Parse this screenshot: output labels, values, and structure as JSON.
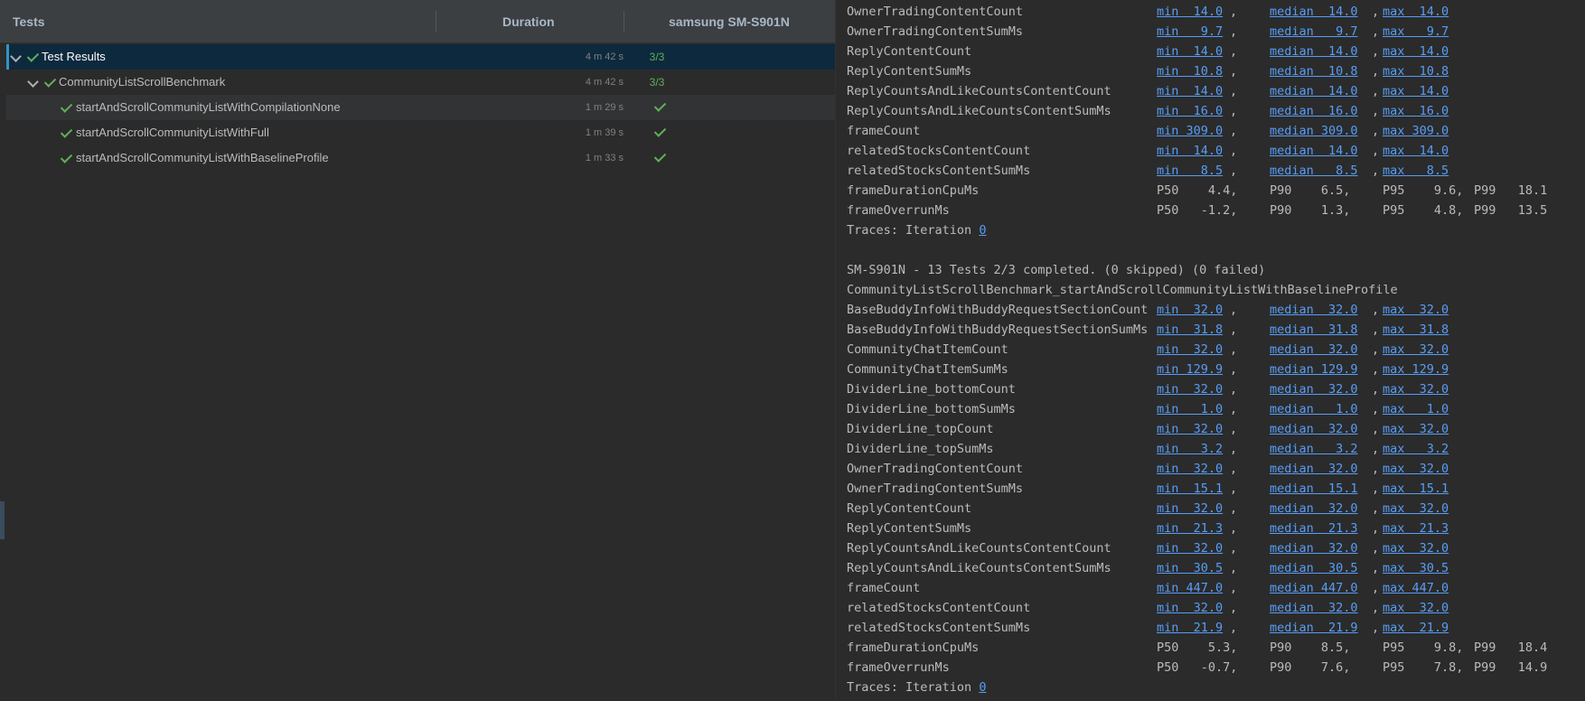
{
  "tree": {
    "header": {
      "tests": "Tests",
      "duration": "Duration",
      "device": "samsung SM-S901N"
    },
    "rows": [
      {
        "label": "Test Results",
        "duration": "4 m 42 s",
        "result": "3/3"
      },
      {
        "label": "CommunityListScrollBenchmark",
        "duration": "4 m 42 s",
        "result": "3/3"
      },
      {
        "label": "startAndScrollCommunityListWithCompilationNone",
        "duration": "1 m 29 s"
      },
      {
        "label": "startAndScrollCommunityListWithFull",
        "duration": "1 m 39 s"
      },
      {
        "label": "startAndScrollCommunityListWithBaselineProfile",
        "duration": "1 m 33 s"
      }
    ]
  },
  "console": {
    "top_metrics": [
      {
        "name": "OwnerTradingContentCount",
        "min": "min  14.0",
        "median": "median  14.0",
        "max": "max  14.0"
      },
      {
        "name": "OwnerTradingContentSumMs",
        "min": "min   9.7",
        "median": "median   9.7",
        "max": "max   9.7"
      },
      {
        "name": "ReplyContentCount",
        "min": "min  14.0",
        "median": "median  14.0",
        "max": "max  14.0"
      },
      {
        "name": "ReplyContentSumMs",
        "min": "min  10.8",
        "median": "median  10.8",
        "max": "max  10.8"
      },
      {
        "name": "ReplyCountsAndLikeCountsContentCount",
        "min": "min  14.0",
        "median": "median  14.0",
        "max": "max  14.0"
      },
      {
        "name": "ReplyCountsAndLikeCountsContentSumMs",
        "min": "min  16.0",
        "median": "median  16.0",
        "max": "max  16.0"
      },
      {
        "name": "frameCount",
        "min": "min 309.0",
        "median": "median 309.0",
        "max": "max 309.0"
      },
      {
        "name": "relatedStocksContentCount",
        "min": "min  14.0",
        "median": "median  14.0",
        "max": "max  14.0"
      },
      {
        "name": "relatedStocksContentSumMs",
        "min": "min   8.5",
        "median": "median   8.5",
        "max": "max   8.5"
      }
    ],
    "top_percentiles": [
      {
        "name": "frameDurationCpuMs",
        "p50": "P50    4.4,",
        "p90": "P90    6.5,",
        "p95": "P95    9.6,",
        "p99": "P99   18.1"
      },
      {
        "name": "frameOverrunMs",
        "p50": "P50   -1.2,",
        "p90": "P90    1.3,",
        "p95": "P95    4.8,",
        "p99": "P99   13.5"
      }
    ],
    "traces_label": "Traces: Iteration ",
    "traces_link": "0",
    "summary_line": "SM-S901N - 13 Tests 2/3 completed. (0 skipped) (0 failed)",
    "benchmark_name": "CommunityListScrollBenchmark_startAndScrollCommunityListWithBaselineProfile",
    "bottom_metrics": [
      {
        "name": "BaseBuddyInfoWithBuddyRequestSectionCount",
        "min": "min  32.0",
        "median": "median  32.0",
        "max": "max  32.0"
      },
      {
        "name": "BaseBuddyInfoWithBuddyRequestSectionSumMs",
        "min": "min  31.8",
        "median": "median  31.8",
        "max": "max  31.8"
      },
      {
        "name": "CommunityChatItemCount",
        "min": "min  32.0",
        "median": "median  32.0",
        "max": "max  32.0"
      },
      {
        "name": "CommunityChatItemSumMs",
        "min": "min 129.9",
        "median": "median 129.9",
        "max": "max 129.9"
      },
      {
        "name": "DividerLine_bottomCount",
        "min": "min  32.0",
        "median": "median  32.0",
        "max": "max  32.0"
      },
      {
        "name": "DividerLine_bottomSumMs",
        "min": "min   1.0",
        "median": "median   1.0",
        "max": "max   1.0"
      },
      {
        "name": "DividerLine_topCount",
        "min": "min  32.0",
        "median": "median  32.0",
        "max": "max  32.0"
      },
      {
        "name": "DividerLine_topSumMs",
        "min": "min   3.2",
        "median": "median   3.2",
        "max": "max   3.2"
      },
      {
        "name": "OwnerTradingContentCount",
        "min": "min  32.0",
        "median": "median  32.0",
        "max": "max  32.0"
      },
      {
        "name": "OwnerTradingContentSumMs",
        "min": "min  15.1",
        "median": "median  15.1",
        "max": "max  15.1"
      },
      {
        "name": "ReplyContentCount",
        "min": "min  32.0",
        "median": "median  32.0",
        "max": "max  32.0"
      },
      {
        "name": "ReplyContentSumMs",
        "min": "min  21.3",
        "median": "median  21.3",
        "max": "max  21.3"
      },
      {
        "name": "ReplyCountsAndLikeCountsContentCount",
        "min": "min  32.0",
        "median": "median  32.0",
        "max": "max  32.0"
      },
      {
        "name": "ReplyCountsAndLikeCountsContentSumMs",
        "min": "min  30.5",
        "median": "median  30.5",
        "max": "max  30.5"
      },
      {
        "name": "frameCount",
        "min": "min 447.0",
        "median": "median 447.0",
        "max": "max 447.0"
      },
      {
        "name": "relatedStocksContentCount",
        "min": "min  32.0",
        "median": "median  32.0",
        "max": "max  32.0"
      },
      {
        "name": "relatedStocksContentSumMs",
        "min": "min  21.9",
        "median": "median  21.9",
        "max": "max  21.9"
      }
    ],
    "bottom_percentiles": [
      {
        "name": "frameDurationCpuMs",
        "p50": "P50    5.3,",
        "p90": "P90    8.5,",
        "p95": "P95    9.8,",
        "p99": "P99   18.4"
      },
      {
        "name": "frameOverrunMs",
        "p50": "P50   -0.7,",
        "p90": "P90    7.6,",
        "p95": "P95    7.8,",
        "p99": "P99   14.9"
      }
    ]
  }
}
